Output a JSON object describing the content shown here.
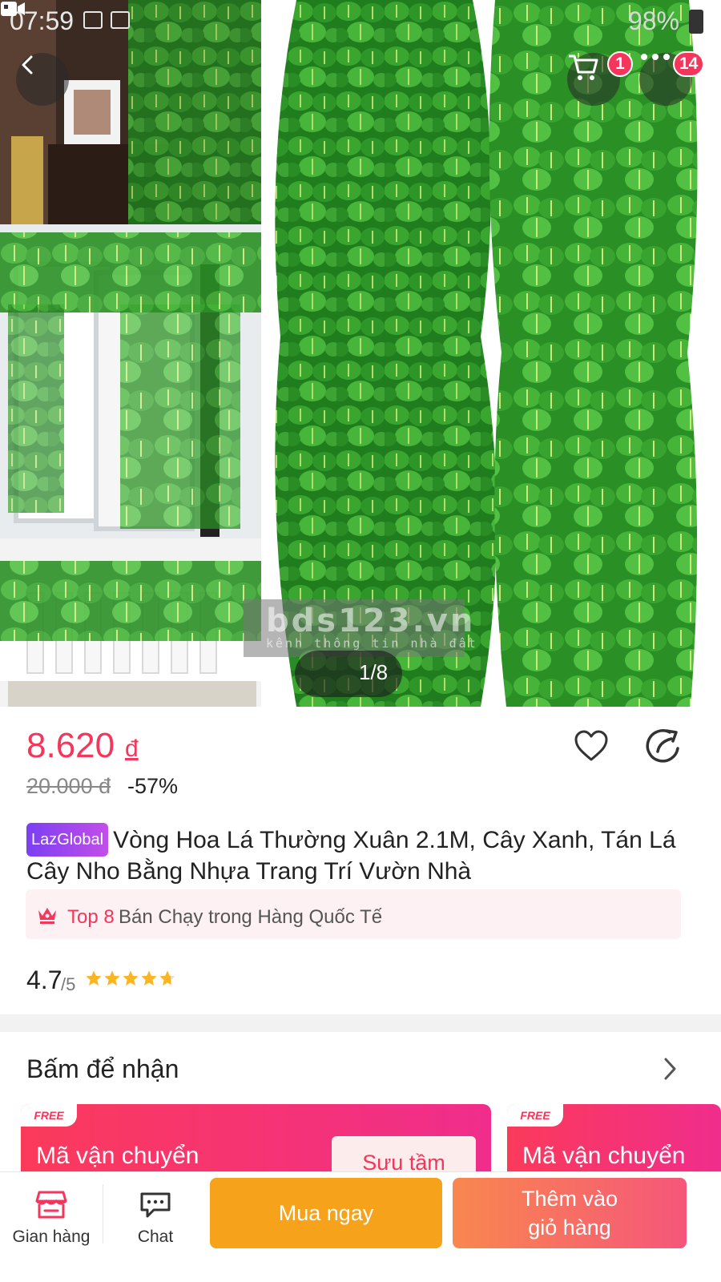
{
  "status_bar": {
    "time": "07:59",
    "battery": "98%"
  },
  "header": {
    "back_icon": "chevron-left-icon",
    "cart_icon": "cart-icon",
    "cart_badge": "1",
    "more_icon": "more-dots-icon",
    "more_badge": "14"
  },
  "gallery": {
    "counter": "1/8",
    "video_icon": "video-camera-icon",
    "watermark_main": "bds123.vn",
    "watermark_sub": "kênh thông tin nhà đất"
  },
  "product": {
    "price": "8.620",
    "currency": "đ",
    "original_price": "20.000 đ",
    "discount": "-57%",
    "brand_tag": "LazGlobal",
    "title": "Vòng Hoa Lá Thường Xuân 2.1M, Cây Xanh, Tán Lá Cây Nho Bằng Nhựa Trang Trí Vườn Nhà",
    "ranking": {
      "top": "Top 8",
      "text": "Bán Chạy trong Hàng Quốc Tế"
    },
    "rating": "4.7",
    "rating_max": "/5",
    "stars": 4.7
  },
  "vouchers": {
    "section_title": "Bấm để nhận",
    "items": [
      {
        "tag": "FREE",
        "name": "Mã vận chuyển",
        "action": "Sưu tầm"
      },
      {
        "tag": "FREE",
        "name": "Mã vận chuyển"
      }
    ]
  },
  "bottom_bar": {
    "shop_label": "Gian hàng",
    "chat_label": "Chat",
    "buy_now": "Mua ngay",
    "add_to_cart_line1": "Thêm vào",
    "add_to_cart_line2": "giỏ hàng"
  },
  "colors": {
    "accent": "#f5365c",
    "buy_button": "#f7a21b",
    "cart_button_start": "#f9874e",
    "cart_button_end": "#f5567a",
    "leaf_green": "#2f9a2a"
  }
}
